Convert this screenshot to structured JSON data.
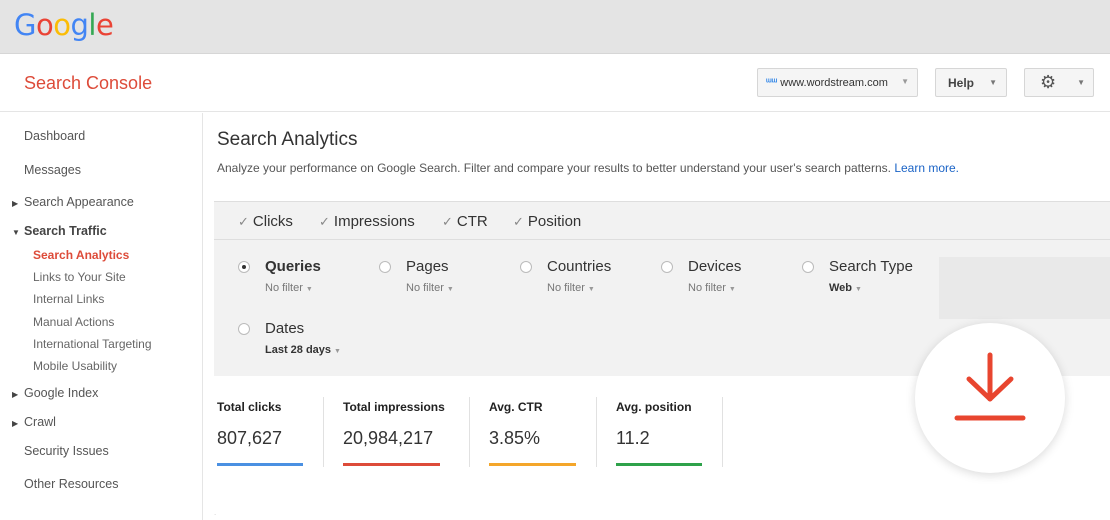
{
  "brand": {
    "logo_letters": [
      {
        "ch": "G",
        "color": "#4285f4"
      },
      {
        "ch": "o",
        "color": "#ea4335"
      },
      {
        "ch": "o",
        "color": "#fbbc05"
      },
      {
        "ch": "g",
        "color": "#4285f4"
      },
      {
        "ch": "l",
        "color": "#34a853"
      },
      {
        "ch": "e",
        "color": "#ea4335"
      }
    ],
    "product": "Search Console"
  },
  "header": {
    "site": "www.wordstream.com",
    "help_label": "Help"
  },
  "sidebar": {
    "dashboard": "Dashboard",
    "messages": "Messages",
    "search_appearance": "Search Appearance",
    "search_traffic": "Search Traffic",
    "sub": {
      "search_analytics": "Search Analytics",
      "links": "Links to Your Site",
      "internal_links": "Internal Links",
      "manual_actions": "Manual Actions",
      "international_targeting": "International Targeting",
      "mobile_usability": "Mobile Usability"
    },
    "google_index": "Google Index",
    "crawl": "Crawl",
    "security_issues": "Security Issues",
    "other_resources": "Other Resources"
  },
  "main": {
    "title": "Search Analytics",
    "description": "Analyze your performance on Google Search. Filter and compare your results to better understand your user's search patterns.",
    "learn_more": "Learn more."
  },
  "metrics": {
    "clicks": "Clicks",
    "impressions": "Impressions",
    "ctr": "CTR",
    "position": "Position"
  },
  "dimensions": {
    "queries": {
      "label": "Queries",
      "sub": "No filter"
    },
    "pages": {
      "label": "Pages",
      "sub": "No filter"
    },
    "countries": {
      "label": "Countries",
      "sub": "No filter"
    },
    "devices": {
      "label": "Devices",
      "sub": "No filter"
    },
    "search_type": {
      "label": "Search Type",
      "sub": "Web"
    },
    "dates": {
      "label": "Dates",
      "sub": "Last 28 days"
    }
  },
  "stats": {
    "total_clicks": {
      "label": "Total clicks",
      "value": "807,627",
      "color": "#4a90e2"
    },
    "total_impressions": {
      "label": "Total impressions",
      "value": "20,984,217",
      "color": "#dd4b39"
    },
    "avg_ctr": {
      "label": "Avg. CTR",
      "value": "3.85%",
      "color": "#f4a62a"
    },
    "avg_position": {
      "label": "Avg. position",
      "value": "11.2",
      "color": "#2ea24a"
    }
  },
  "colors": {
    "accent": "#dd4b39",
    "link": "#1a63c6"
  },
  "icons": {
    "download": "download-icon",
    "gear": "gear-icon",
    "site": "wordstream-logo-icon"
  }
}
